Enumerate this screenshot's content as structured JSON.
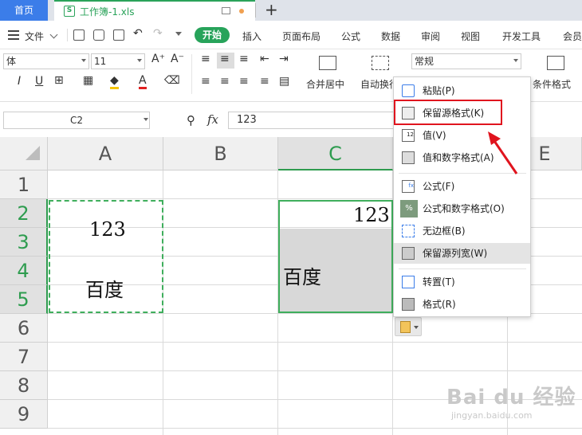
{
  "tabs": {
    "home_label": "首页",
    "doc_icon_glyph": "S",
    "doc_title": "工作簿-1.xls",
    "new_tab": "+"
  },
  "menu": {
    "file": "文件",
    "items": [
      "开始",
      "插入",
      "页面布局",
      "公式",
      "数据",
      "审阅",
      "视图",
      "开发工具",
      "会员"
    ]
  },
  "ribbon": {
    "font_name": "体",
    "font_size": "11",
    "number_format": "常规",
    "merge_center": "合并居中",
    "wrap_text": "自动换行",
    "conditional_format": "条件格式"
  },
  "formula_bar": {
    "cell_ref": "C2",
    "fx": "fx",
    "value": "123"
  },
  "grid": {
    "columns": [
      "A",
      "B",
      "C",
      "",
      "E"
    ],
    "rows": [
      "1",
      "2",
      "3",
      "4",
      "5",
      "6",
      "7",
      "8",
      "9"
    ],
    "cells": {
      "A2": "123",
      "A4": "百度",
      "C2": "123",
      "C4": "百度"
    }
  },
  "context_menu": {
    "items": [
      "粘贴(P)",
      "保留源格式(K)",
      "值(V)",
      "值和数字格式(A)",
      "公式(F)",
      "公式和数字格式(O)",
      "无边框(B)",
      "保留源列宽(W)",
      "转置(T)",
      "格式(R)"
    ],
    "icon_badges": {
      "values": "12",
      "formulas": "fx",
      "formula_number": "%"
    }
  },
  "watermark": {
    "brand": "Bai du 经验",
    "url": "jingyan.baidu.com"
  },
  "colors": {
    "accent_green": "#2e9c4f",
    "tab_blue": "#3b7de9",
    "highlight_red": "#e0141e"
  }
}
